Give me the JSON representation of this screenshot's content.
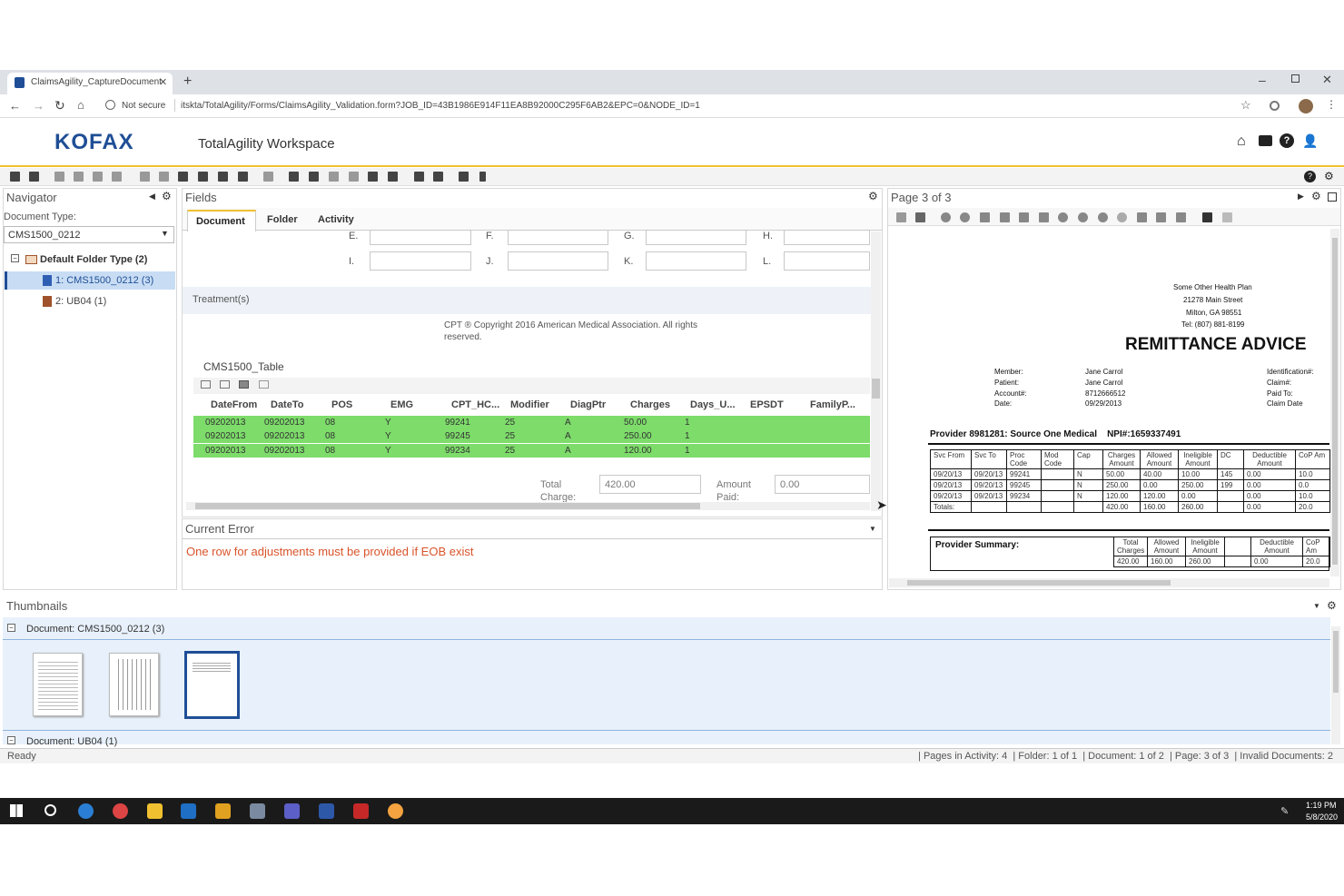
{
  "browser": {
    "tab_title": "ClaimsAgility_CaptureDocument",
    "not_secure": "Not secure",
    "url": "itskta/TotalAgility/Forms/ClaimsAgility_Validation.form?JOB_ID=43B1986E914F11EA8B92000C295F6AB2&EPC=0&NODE_ID=1"
  },
  "app": {
    "logo": "KOFAX",
    "title": "TotalAgility Workspace"
  },
  "navigator": {
    "title": "Navigator",
    "doc_type_label": "Document Type:",
    "doc_type_value": "CMS1500_0212",
    "folder": "Default Folder Type (2)",
    "items": [
      "1: CMS1500_0212 (3)",
      "2: UB04 (1)"
    ]
  },
  "fields": {
    "title": "Fields",
    "tabs": [
      "Document",
      "Folder",
      "Activity"
    ],
    "letters_row1": [
      "E.",
      "F.",
      "G.",
      "H."
    ],
    "letters_row2": [
      "I.",
      "J.",
      "K.",
      "L."
    ],
    "treatments": "Treatment(s)",
    "copyright": "CPT ® Copyright 2016 American Medical Association. All rights reserved.",
    "table_title": "CMS1500_Table",
    "columns": [
      "DateFrom",
      "DateTo",
      "POS",
      "EMG",
      "CPT_HC...",
      "Modifier",
      "DiagPtr",
      "Charges",
      "Days_U...",
      "EPSDT",
      "FamilyP..."
    ],
    "rows": [
      [
        "09202013",
        "09202013",
        "08",
        "Y",
        "99241",
        "25",
        "A",
        "50.00",
        "1"
      ],
      [
        "09202013",
        "09202013",
        "08",
        "Y",
        "99245",
        "25",
        "A",
        "250.00",
        "1"
      ],
      [
        "09202013",
        "09202013",
        "08",
        "Y",
        "99234",
        "25",
        "A",
        "120.00",
        "1"
      ]
    ],
    "total_charge_label": "Total Charge:",
    "total_charge_value": "420.00",
    "amount_paid_label": "Amount Paid:",
    "amount_paid_value": "0.00"
  },
  "error": {
    "title": "Current Error",
    "message": "One row for adjustments must be provided if EOB exist"
  },
  "viewer": {
    "page": "Page 3 of 3",
    "payer_lines": [
      "Some Other Health Plan",
      "21278 Main Street",
      "Milton, GA 98551",
      "Tel: (807) 881-8199"
    ],
    "heading": "REMITTANCE ADVICE",
    "left_labels": [
      "Member:",
      "Patient:",
      "Account#:",
      "Date:"
    ],
    "left_values": [
      "Jane Carrol",
      "Jane Carrol",
      "8712666512",
      "09/29/2013"
    ],
    "right_labels": [
      "Identification#:",
      "Claim#:",
      "Paid To:",
      "Claim Date"
    ],
    "provider_line": "Provider 8981281: Source One Medical    NPI#:1659337491",
    "table_header1": [
      "Svc From",
      "Svc To",
      "Proc Code",
      "Mod Code",
      "Cap",
      "Charges Amount",
      "Allowed Amount",
      "Ineligible Amount",
      "DC",
      "Deductible Amount",
      "CoP Am"
    ],
    "table_rows": [
      [
        "09/20/13",
        "09/20/13",
        "99241",
        "",
        "N",
        "50.00",
        "40.00",
        "10.00",
        "145",
        "0.00",
        "10.0"
      ],
      [
        "09/20/13",
        "09/20/13",
        "99245",
        "",
        "N",
        "250.00",
        "0.00",
        "250.00",
        "199",
        "0.00",
        "0.0"
      ],
      [
        "09/20/13",
        "09/20/13",
        "99234",
        "",
        "N",
        "120.00",
        "120.00",
        "0.00",
        "",
        "0.00",
        "10.0"
      ],
      [
        "Totals:",
        "",
        "",
        "",
        "",
        "420.00",
        "160.00",
        "260.00",
        "",
        "0.00",
        "20.0"
      ]
    ],
    "summary_label": "Provider Summary:",
    "summary_header": [
      "Total Charges",
      "Allowed Amount",
      "Ineligible Amount",
      "",
      "Deductible Amount",
      "CoP Am"
    ],
    "summary_values": [
      "420.00",
      "160.00",
      "260.00",
      "",
      "0.00",
      "20.0"
    ]
  },
  "thumbnails": {
    "title": "Thumbnails",
    "doc1": "Document: CMS1500_0212 (3)",
    "doc2": "Document: UB04 (1)"
  },
  "status": {
    "left": "Ready",
    "right": "| Pages in Activity: 4  | Folder: 1 of 1  | Document: 1 of 2  | Page: 3 of 3  | Invalid Documents: 2"
  },
  "taskbar": {
    "time": "1:19 PM",
    "date": "5/8/2020"
  },
  "colors": {
    "accent": "#f0c030",
    "brand": "#1f4e96",
    "row_highlight": "#7ddc6a",
    "error": "#d9542b"
  }
}
